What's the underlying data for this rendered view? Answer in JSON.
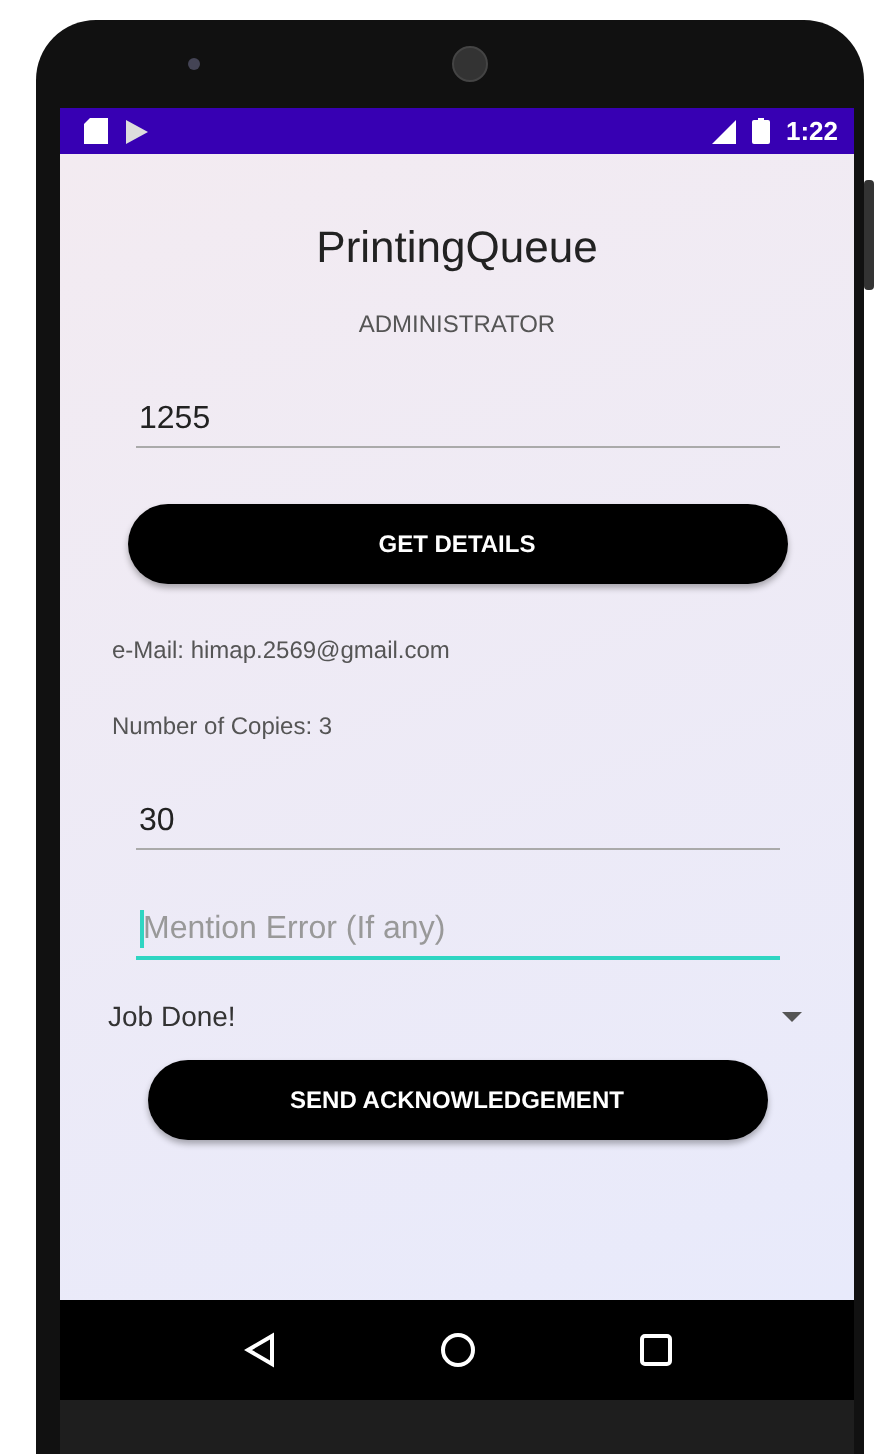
{
  "status_bar": {
    "time": "1:22"
  },
  "app": {
    "title": "PrintingQueue",
    "role": "ADMINISTRATOR"
  },
  "fields": [
    {
      "kind": "input",
      "value": "1255",
      "focused": false
    },
    {
      "kind": "button",
      "label": "GET DETAILS"
    },
    {
      "kind": "info",
      "text": "e-Mail: himap.2569@gmail.com"
    },
    {
      "kind": "info",
      "text": "Number of Copies: 3"
    },
    {
      "kind": "input",
      "value": "30",
      "focused": false
    },
    {
      "kind": "input",
      "placeholder": "Mention Error (If any)",
      "focused": true
    },
    {
      "kind": "dropdown",
      "value": "Job Done!"
    },
    {
      "kind": "button",
      "label": "SEND ACKNOWLEDGEMENT"
    }
  ]
}
